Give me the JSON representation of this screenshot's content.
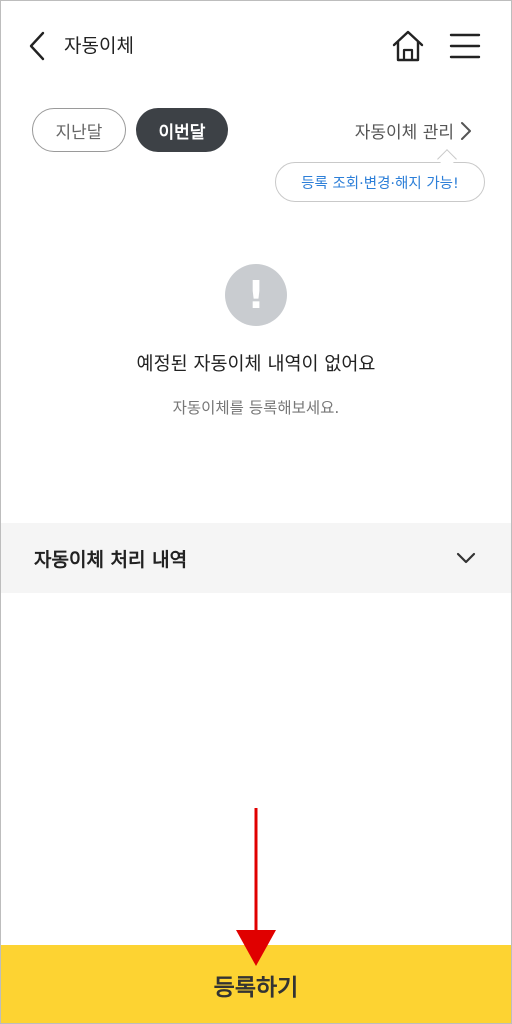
{
  "header": {
    "title": "자동이체"
  },
  "month_toggle": {
    "last_month": "지난달",
    "this_month": "이번달",
    "selected": "this_month"
  },
  "manage": {
    "label": "자동이체 관리",
    "tooltip": "등록 조회·변경·해지 가능!"
  },
  "empty_state": {
    "icon": "exclamation-icon",
    "title": "예정된 자동이체 내역이 없어요",
    "subtitle": "자동이체를 등록해보세요."
  },
  "section": {
    "title": "자동이체 처리 내역"
  },
  "footer": {
    "register_label": "등록하기"
  },
  "colors": {
    "accent_yellow": "#fdd332",
    "pill_dark": "#3d4146",
    "link_blue": "#2d7fd8",
    "annotation_red": "#e00000"
  }
}
